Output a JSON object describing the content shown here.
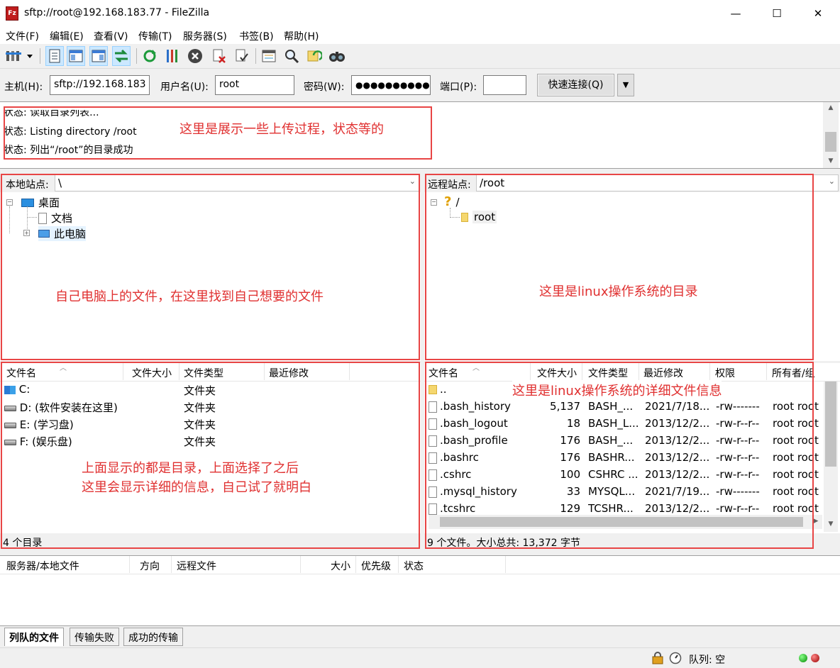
{
  "window": {
    "title": "sftp://root@192.168.183.77 - FileZilla",
    "app_icon_letter": "Fz",
    "minimize": "—",
    "maximize": "☐",
    "close": "✕"
  },
  "menu": [
    "文件(F)",
    "编辑(E)",
    "查看(V)",
    "传输(T)",
    "服务器(S)",
    "书签(B)",
    "帮助(H)"
  ],
  "quickconnect": {
    "host_label": "主机(H):",
    "host_value": "sftp://192.168.183",
    "user_label": "用户名(U):",
    "user_value": "root",
    "pass_label": "密码(W):",
    "pass_value": "●●●●●●●●●●",
    "port_label": "端口(P):",
    "port_value": "",
    "connect_button": "快速连接(Q)",
    "dropdown": "▼"
  },
  "log": {
    "lines": [
      "状态:  读取目录列表...",
      "状态:  Listing directory /root",
      "状态:  列出“/root”的目录成功"
    ]
  },
  "local": {
    "site_label": "本地站点:",
    "site_path": "\\",
    "tree": [
      "桌面",
      "文档",
      "此电脑"
    ],
    "headers": [
      "文件名",
      "文件大小",
      "文件类型",
      "最近修改"
    ],
    "rows": [
      {
        "name": "C:",
        "type": "文件夹"
      },
      {
        "name": "D: (软件安装在这里)",
        "type": "文件夹"
      },
      {
        "name": "E: (学习盘)",
        "type": "文件夹"
      },
      {
        "name": "F: (娱乐盘)",
        "type": "文件夹"
      }
    ],
    "status": "4 个目录"
  },
  "remote": {
    "site_label": "远程站点:",
    "site_path": "/root",
    "tree": [
      "/",
      "root"
    ],
    "headers": [
      "文件名",
      "文件大小",
      "文件类型",
      "最近修改",
      "权限",
      "所有者/组"
    ],
    "rows": [
      {
        "name": "..",
        "size": "",
        "type": "",
        "modified": "",
        "perm": "",
        "owner": ""
      },
      {
        "name": ".bash_history",
        "size": "5,137",
        "type": "BASH_...",
        "modified": "2021/7/18...",
        "perm": "-rw-------",
        "owner": "root root"
      },
      {
        "name": ".bash_logout",
        "size": "18",
        "type": "BASH_L...",
        "modified": "2013/12/2...",
        "perm": "-rw-r--r--",
        "owner": "root root"
      },
      {
        "name": ".bash_profile",
        "size": "176",
        "type": "BASH_...",
        "modified": "2013/12/2...",
        "perm": "-rw-r--r--",
        "owner": "root root"
      },
      {
        "name": ".bashrc",
        "size": "176",
        "type": "BASHR...",
        "modified": "2013/12/2...",
        "perm": "-rw-r--r--",
        "owner": "root root"
      },
      {
        "name": ".cshrc",
        "size": "100",
        "type": "CSHRC ...",
        "modified": "2013/12/2...",
        "perm": "-rw-r--r--",
        "owner": "root root"
      },
      {
        "name": ".mysql_history",
        "size": "33",
        "type": "MYSQL...",
        "modified": "2021/7/19...",
        "perm": "-rw-------",
        "owner": "root root"
      },
      {
        "name": ".tcshrc",
        "size": "129",
        "type": "TCSHR...",
        "modified": "2013/12/2...",
        "perm": "-rw-r--r--",
        "owner": "root root"
      }
    ],
    "status": "9 个文件。大小总共: 13,372 字节"
  },
  "queue": {
    "headers": [
      "服务器/本地文件",
      "方向",
      "远程文件",
      "大小",
      "优先级",
      "状态"
    ],
    "tabs": [
      "列队的文件",
      "传输失败",
      "成功的传输"
    ]
  },
  "statusbar": {
    "queue_text": "队列: 空"
  },
  "annotations": {
    "log": "这里是展示一些上传过程，状态等的",
    "local_tree": "自己电脑上的文件，在这里找到自己想要的文件",
    "remote_tree": "这里是linux操作系统的目录",
    "remote_list": "这里是linux操作系统的详细文件信息",
    "local_list_1": "上面显示的都是目录，上面选择了之后",
    "local_list_2": "这里会显示详细的信息，自己试了就明白"
  },
  "colors": {
    "annotation_red": "#e03030",
    "box_red": "#e84545",
    "selection": "#cce8ff"
  }
}
